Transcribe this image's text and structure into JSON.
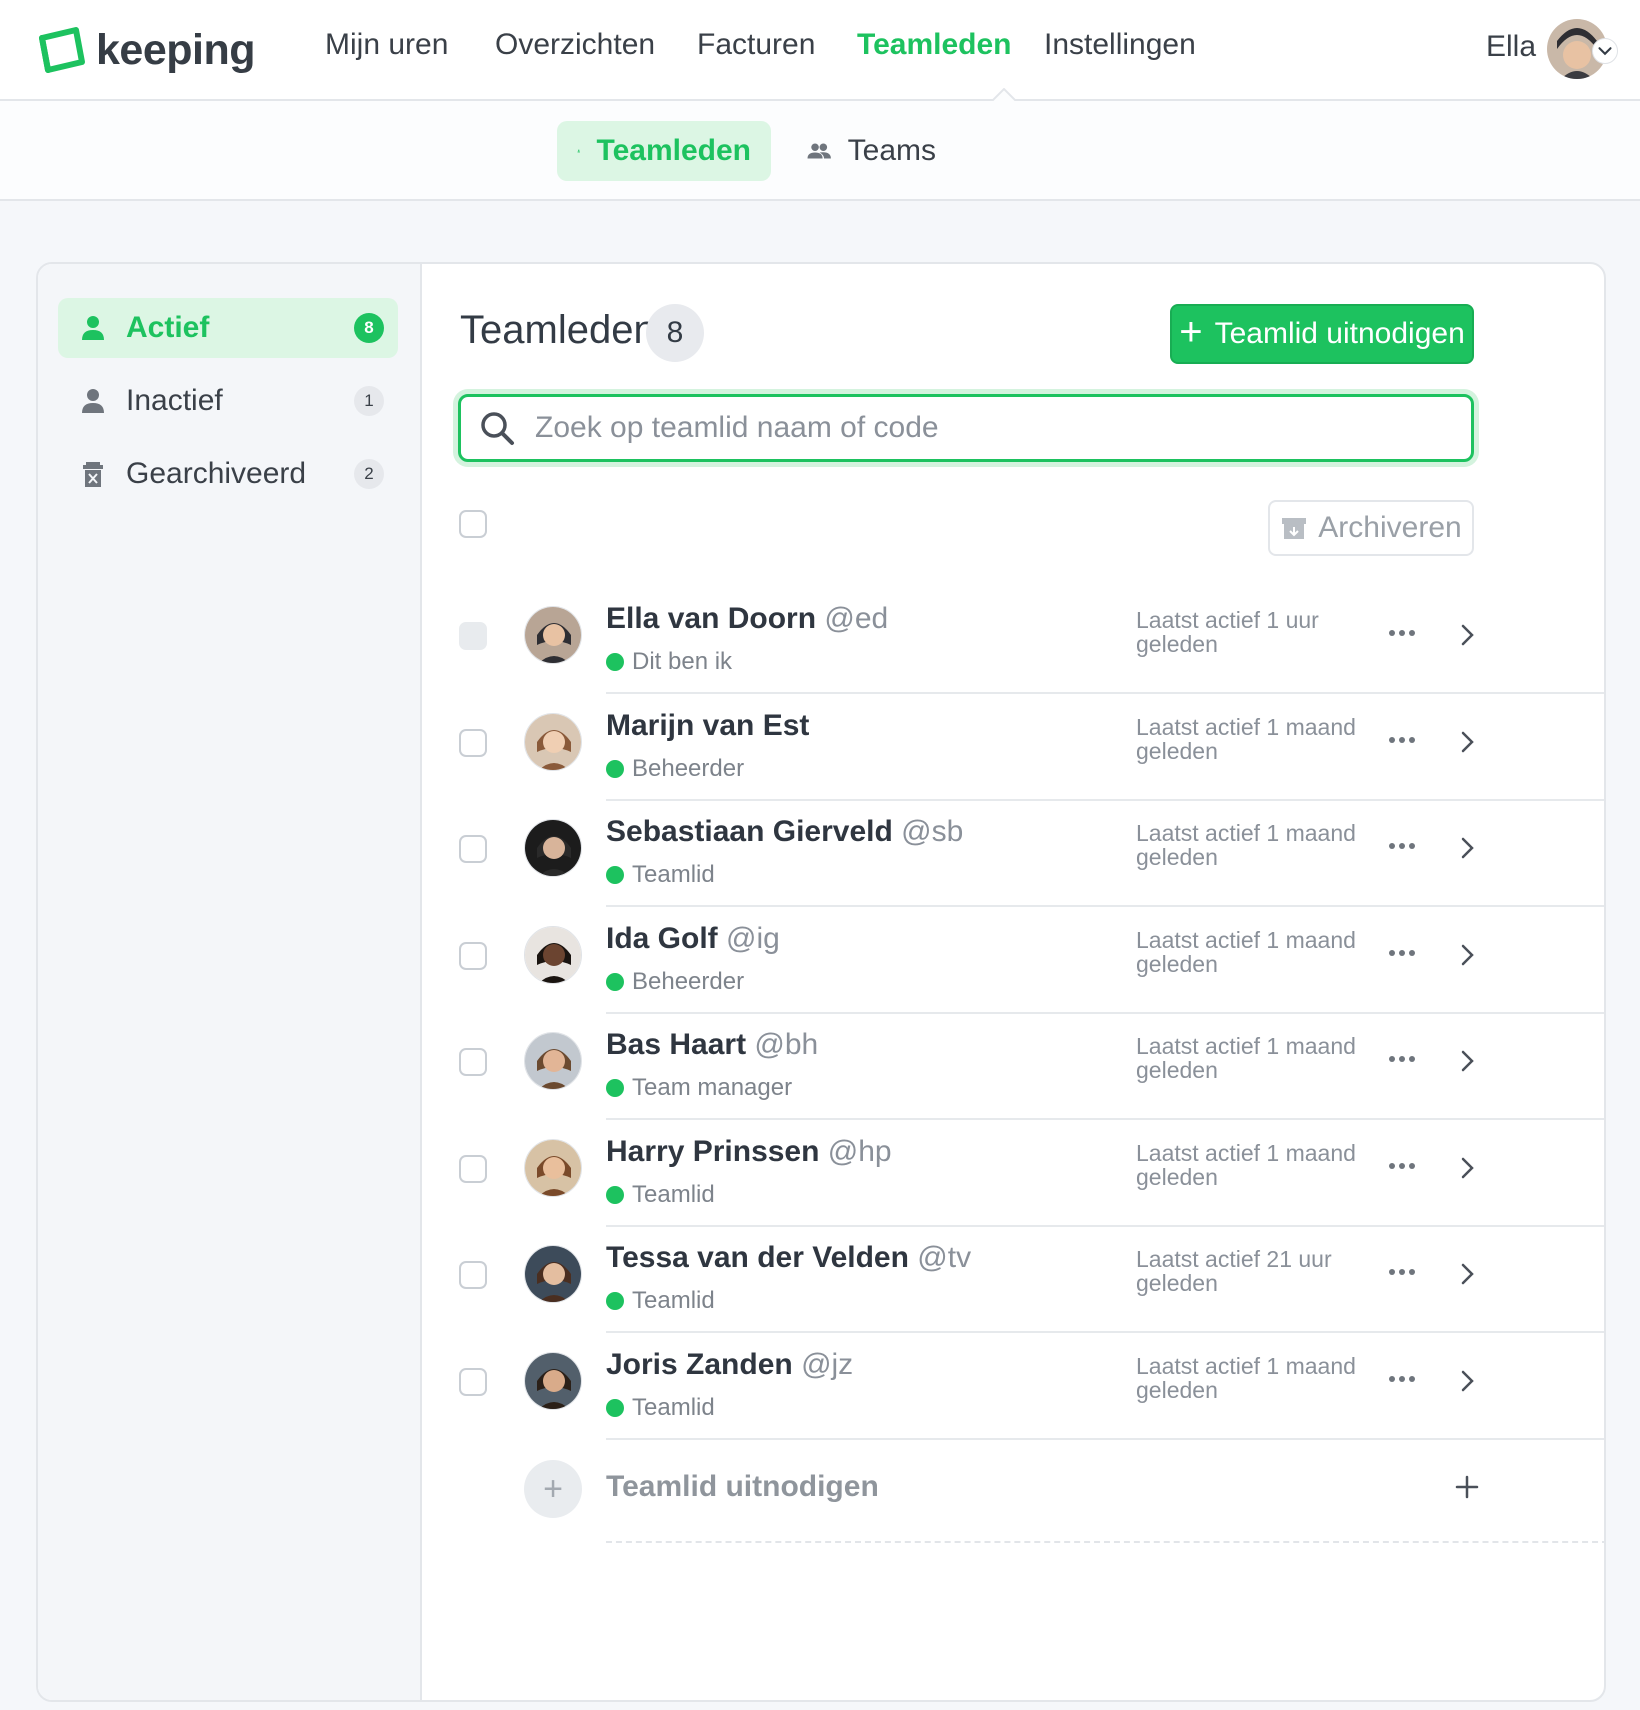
{
  "brand": {
    "name": "keeping",
    "accent": "#1dc25f"
  },
  "nav": {
    "items": [
      "Mijn uren",
      "Overzichten",
      "Facturen",
      "Teamleden",
      "Instellingen"
    ],
    "active": "Teamleden",
    "user_name": "Ella"
  },
  "subnav": {
    "tabs": [
      "Teamleden",
      "Teams"
    ],
    "active": "Teamleden"
  },
  "sidebar": {
    "items": [
      {
        "label": "Actief",
        "count": "8",
        "icon": "person-icon"
      },
      {
        "label": "Inactief",
        "count": "1",
        "icon": "person-icon"
      },
      {
        "label": "Gearchiveerd",
        "count": "2",
        "icon": "archive-trash-icon"
      }
    ]
  },
  "main": {
    "title": "Teamleden",
    "count": "8",
    "invite_button": "Teamlid uitnodigen",
    "search_placeholder": "Zoek op teamlid naam of code",
    "archive_button": "Archiveren",
    "add_row_label": "Teamlid uitnodigen"
  },
  "members": [
    {
      "name": "Ella van Doorn",
      "handle": "@ed",
      "role": "Dit ben ik",
      "last_active": "Laatst actief 1 uur geleden"
    },
    {
      "name": "Marijn van Est",
      "handle": "",
      "role": "Beheerder",
      "last_active": "Laatst actief 1 maand geleden"
    },
    {
      "name": "Sebastiaan Gierveld",
      "handle": "@sb",
      "role": "Teamlid",
      "last_active": "Laatst actief 1 maand geleden"
    },
    {
      "name": "Ida Golf",
      "handle": "@ig",
      "role": "Beheerder",
      "last_active": "Laatst actief 1 maand geleden"
    },
    {
      "name": "Bas Haart",
      "handle": "@bh",
      "role": "Team manager",
      "last_active": "Laatst actief 1 maand geleden"
    },
    {
      "name": "Harry Prinssen",
      "handle": "@hp",
      "role": "Teamlid",
      "last_active": "Laatst actief 1 maand geleden"
    },
    {
      "name": "Tessa van der Velden",
      "handle": "@tv",
      "role": "Teamlid",
      "last_active": "Laatst actief 21 uur geleden"
    },
    {
      "name": "Joris Zanden",
      "handle": "@jz",
      "role": "Teamlid",
      "last_active": "Laatst actief 1 maand geleden"
    }
  ]
}
